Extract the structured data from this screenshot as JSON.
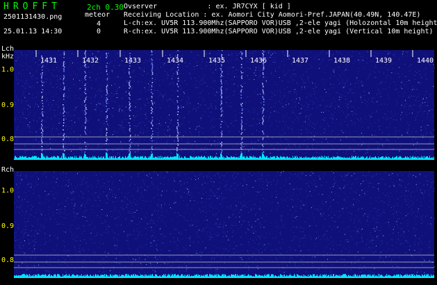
{
  "header": {
    "app_title": "HROFFT",
    "version": "2ch 0.30",
    "filename": "2501131430.png",
    "meteor_label": "meteor",
    "meteor_lch_count": "4",
    "meteor_rch_count": "0",
    "timestamp": "25.01.13 14:30",
    "observer": "Ovserver            : ex. JR7CYX [ kid ]",
    "location": "Receiving Location : ex. Aomori City Aomori-Pref.JAPAN(40.49N, 140.47E)",
    "lch_info": "L-ch:ex. UV5R 113.900Mhz(SAPPORO VOR)USB ,2-ele yagi (Holozontal 10m height",
    "rch_info": "R-ch:ex. UV5R 113.900Mhz(SAPPORO VOR)USB ,2-ele yagi (Vertical 10m height)"
  },
  "panels": [
    {
      "label": "Lch",
      "unit": "kHz",
      "y_ticks": [
        "1.0",
        "0.9",
        "0.8"
      ],
      "meteor_count": 4
    },
    {
      "label": "Rch",
      "unit": "",
      "y_ticks": [
        "1.0",
        "0.9",
        "0.8"
      ],
      "meteor_count": 0
    }
  ],
  "time_labels": [
    "1431",
    "1432",
    "1433",
    "1434",
    "1435",
    "1436",
    "1437",
    "1438",
    "1439",
    "1440"
  ],
  "colors": {
    "background": "#000000",
    "spectrum_bg": "#10107a",
    "baseline": "#00e5ff",
    "title_green": "#00ff00",
    "label_yellow": "#ffff00",
    "ref_lines": "#c8c8c8"
  }
}
